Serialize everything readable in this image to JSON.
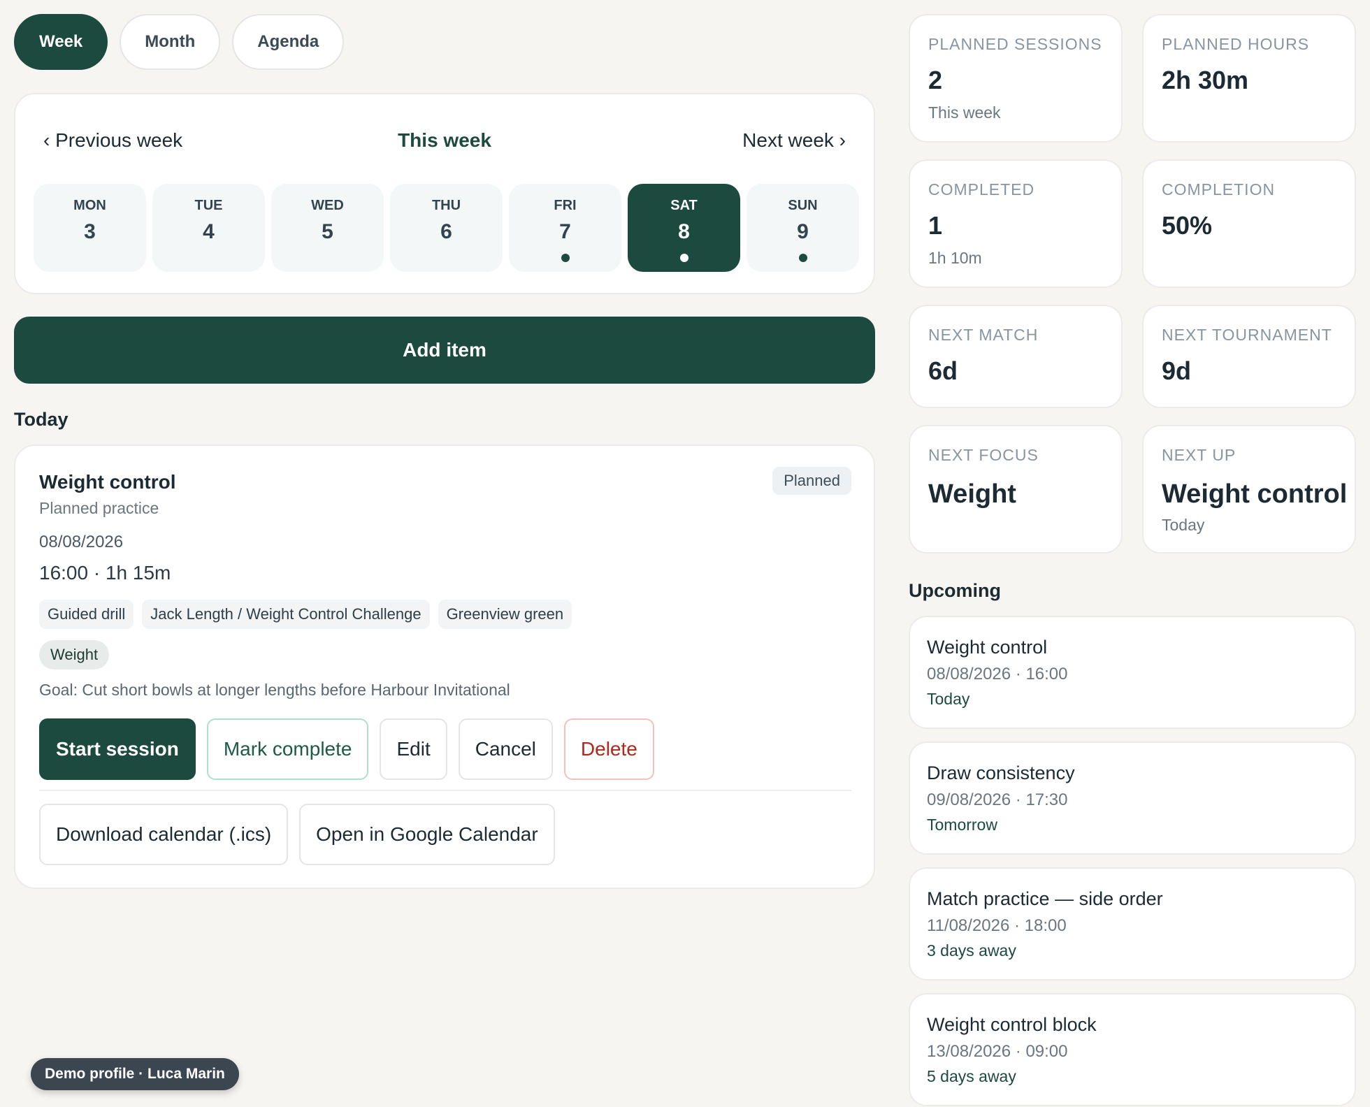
{
  "view_tabs": [
    {
      "label": "Week",
      "active": true
    },
    {
      "label": "Month",
      "active": false
    },
    {
      "label": "Agenda",
      "active": false
    }
  ],
  "week_nav": {
    "previous": "‹ Previous week",
    "current": "This week",
    "next": "Next week ›"
  },
  "days": [
    {
      "name": "MON",
      "num": "3",
      "has_item": false,
      "selected": false
    },
    {
      "name": "TUE",
      "num": "4",
      "has_item": false,
      "selected": false
    },
    {
      "name": "WED",
      "num": "5",
      "has_item": false,
      "selected": false
    },
    {
      "name": "THU",
      "num": "6",
      "has_item": false,
      "selected": false
    },
    {
      "name": "FRI",
      "num": "7",
      "has_item": true,
      "selected": false
    },
    {
      "name": "SAT",
      "num": "8",
      "has_item": true,
      "selected": true
    },
    {
      "name": "SUN",
      "num": "9",
      "has_item": true,
      "selected": false
    }
  ],
  "add_item_label": "Add item",
  "today_title": "Today",
  "session": {
    "title": "Weight control",
    "status": "Planned",
    "subtitle": "Planned practice",
    "date": "08/08/2026",
    "time": "16:00 · 1h 15m",
    "chips": [
      "Guided drill",
      "Jack Length / Weight Control Challenge",
      "Greenview green"
    ],
    "focus": "Weight",
    "goal": "Goal: Cut short bowls at longer lengths before Harbour Invitational",
    "actions": {
      "start": "Start session",
      "complete": "Mark complete",
      "edit": "Edit",
      "cancel": "Cancel",
      "delete": "Delete"
    },
    "calendar": {
      "ics": "Download calendar (.ics)",
      "google": "Open in Google Calendar"
    }
  },
  "stats": {
    "planned_sessions": {
      "label": "PLANNED SESSIONS",
      "value": "2",
      "sub": "This week"
    },
    "planned_hours": {
      "label": "PLANNED HOURS",
      "value": "2h 30m"
    },
    "completed": {
      "label": "COMPLETED",
      "value": "1",
      "sub": "1h 10m"
    },
    "completion": {
      "label": "COMPLETION",
      "value": "50%"
    },
    "next_match": {
      "label": "NEXT MATCH",
      "value": "6d"
    },
    "next_tournament": {
      "label": "NEXT TOURNAMENT",
      "value": "9d"
    },
    "next_focus": {
      "label": "NEXT FOCUS",
      "value": "Weight"
    },
    "next_up": {
      "label": "NEXT UP",
      "value": "Weight control",
      "sub": "Today"
    }
  },
  "upcoming_title": "Upcoming",
  "upcoming": [
    {
      "title": "Weight control",
      "datetime": "08/08/2026 · 16:00",
      "relative": "Today"
    },
    {
      "title": "Draw consistency",
      "datetime": "09/08/2026 · 17:30",
      "relative": "Tomorrow"
    },
    {
      "title": "Match practice — side order",
      "datetime": "11/08/2026 · 18:00",
      "relative": "3 days away"
    },
    {
      "title": "Weight control block",
      "datetime": "13/08/2026 · 09:00",
      "relative": "5 days away"
    }
  ],
  "demo_profile": "Demo profile · Luca Marin",
  "colors": {
    "accent": "#1d4a3f",
    "background": "#f6f5f1",
    "danger": "#b0281c"
  }
}
